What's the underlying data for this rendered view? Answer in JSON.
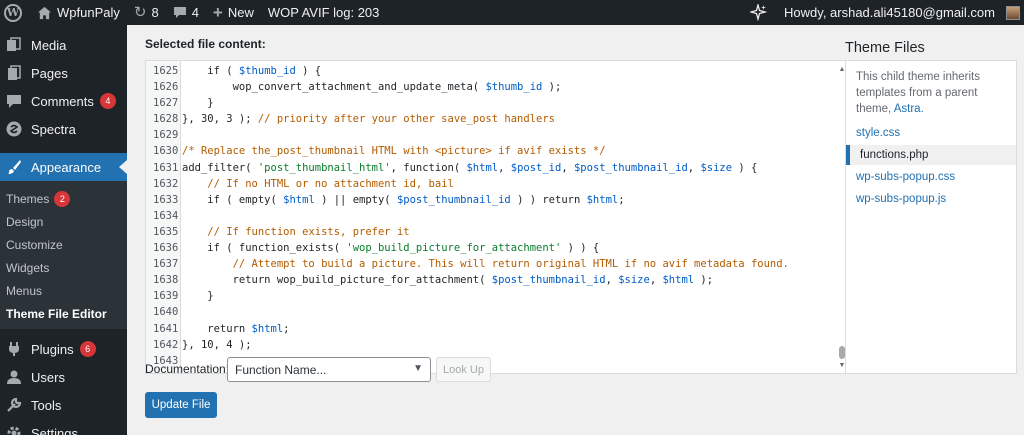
{
  "adminbar": {
    "site_name": "WpfunPaly",
    "updates_count": "8",
    "comments_count": "4",
    "new_label": "New",
    "avif_log": "WOP AVIF log: 203",
    "howdy": "Howdy, arshad.ali45180@gmail.com"
  },
  "sidebar": {
    "media": "Media",
    "pages": "Pages",
    "comments": "Comments",
    "comments_badge": "4",
    "spectra": "Spectra",
    "appearance": "Appearance",
    "submenu": {
      "themes": "Themes",
      "themes_badge": "2",
      "design": "Design",
      "customize": "Customize",
      "widgets": "Widgets",
      "menus": "Menus",
      "theme_file_editor": "Theme File Editor"
    },
    "plugins": "Plugins",
    "plugins_badge": "6",
    "users": "Users",
    "tools": "Tools",
    "settings": "Settings"
  },
  "editor": {
    "selected_label": "Selected file content:",
    "lines": [
      {
        "n": "1625",
        "code": "    if ( $thumb_id ) {"
      },
      {
        "n": "1626",
        "code": "        wop_convert_attachment_and_update_meta( $thumb_id );"
      },
      {
        "n": "1627",
        "code": "    }"
      },
      {
        "n": "1628",
        "code": "}, 30, 3 ); // priority after your other save_post handlers"
      },
      {
        "n": "1629",
        "code": ""
      },
      {
        "n": "1630",
        "code": "/* Replace the_post_thumbnail HTML with <picture> if avif exists */"
      },
      {
        "n": "1631",
        "code": "add_filter( 'post_thumbnail_html', function( $html, $post_id, $post_thumbnail_id, $size ) {"
      },
      {
        "n": "1632",
        "code": "    // If no HTML or no attachment id, bail"
      },
      {
        "n": "1633",
        "code": "    if ( empty( $html ) || empty( $post_thumbnail_id ) ) return $html;"
      },
      {
        "n": "1634",
        "code": ""
      },
      {
        "n": "1635",
        "code": "    // If function exists, prefer it"
      },
      {
        "n": "1636",
        "code": "    if ( function_exists( 'wop_build_picture_for_attachment' ) ) {"
      },
      {
        "n": "1637",
        "code": "        // Attempt to build a picture. This will return original HTML if no avif metadata found."
      },
      {
        "n": "1638",
        "code": "        return wop_build_picture_for_attachment( $post_thumbnail_id, $size, $html );"
      },
      {
        "n": "1639",
        "code": "    }"
      },
      {
        "n": "1640",
        "code": ""
      },
      {
        "n": "1641",
        "code": "    return $html;"
      },
      {
        "n": "1642",
        "code": "}, 10, 4 );"
      },
      {
        "n": "1643",
        "code": ""
      }
    ]
  },
  "theme_files": {
    "title": "Theme Files",
    "note_prefix": "This child theme inherits templates from a parent theme,",
    "parent_theme": "Astra.",
    "files": [
      "style.css",
      "functions.php",
      "wp-subs-popup.css",
      "wp-subs-popup.js"
    ],
    "current_file": "functions.php"
  },
  "documentation": {
    "label": "Documentation:",
    "select_value": "Function Name...",
    "lookup_label": "Look Up"
  },
  "update_button": "Update File",
  "colors": {
    "adminbar_bg": "#1d2327",
    "accent": "#2271b1",
    "badge": "#d63638"
  }
}
